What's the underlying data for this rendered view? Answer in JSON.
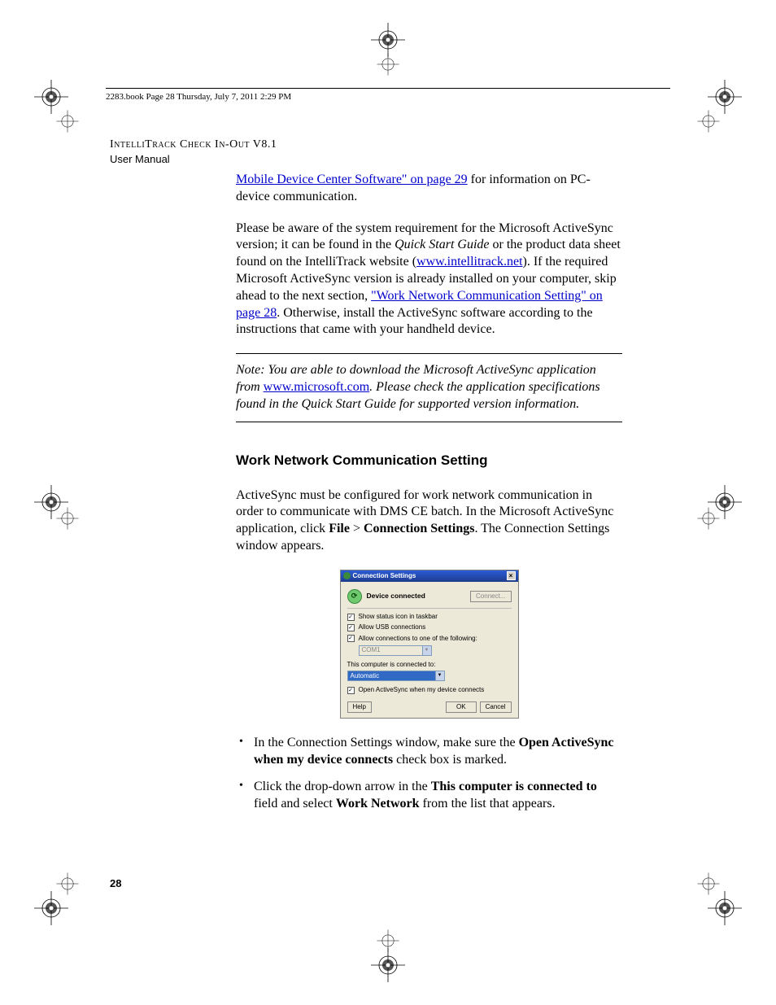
{
  "header": {
    "file_stamp": "2283.book  Page 28  Thursday, July 7, 2011  2:29 PM"
  },
  "running": {
    "title": "IntelliTrack Check In-Out V8.1",
    "subtitle": "User Manual"
  },
  "text": {
    "p1_link": "Mobile Device Center Software\" on page 29",
    "p1_tail": " for information on PC-device communication.",
    "p2_a": "Please be aware of the system requirement for the Microsoft ActiveSync version; it can be found in the ",
    "p2_i": "Quick Start Guide",
    "p2_b": " or the product data sheet found on the IntelliTrack website (",
    "p2_link1": "www.intellitrack.net",
    "p2_c": "). If the required Microsoft ActiveSync version is already installed on your computer, skip ahead to the next section, ",
    "p2_link2": "\"Work Network Communication Setting\" on page 28",
    "p2_d": ". Otherwise, install the ActiveSync software according to the instructions that came with your handheld device.",
    "note_a": "Note:   You are able to download the Microsoft ActiveSync application from ",
    "note_link": "www.microsoft.com",
    "note_b": ". Please check the application specifications found in the Quick Start Guide for supported version information.",
    "h2": "Work Network Communication Setting",
    "p3_a": "ActiveSync must be configured for work network communication in order to communicate with DMS CE batch. In the Microsoft ActiveSync application, click ",
    "p3_b1": "File",
    "p3_gt": " > ",
    "p3_b2": "Connection Settings",
    "p3_c": ". The Connection Settings window appears.",
    "b1_a": "In the Connection Settings window, make sure the ",
    "b1_b": "Open ActiveSync when my device connects",
    "b1_c": " check box is marked.",
    "b2_a": "Click the drop-down arrow in the ",
    "b2_b": "This computer is connected to",
    "b2_c": " field and select ",
    "b2_d": "Work Network",
    "b2_e": " from the list that appears."
  },
  "dialog": {
    "title": "Connection Settings",
    "status": "Device connected",
    "connect_btn": "Connect...",
    "cb1": "Show status icon in taskbar",
    "cb2": "Allow USB connections",
    "cb3": "Allow connections to one of the following:",
    "combo1": "COM1",
    "label2": "This computer is connected to:",
    "combo2": "Automatic",
    "cb4": "Open ActiveSync when my device connects",
    "help": "Help",
    "ok": "OK",
    "cancel": "Cancel"
  },
  "page_number": "28"
}
